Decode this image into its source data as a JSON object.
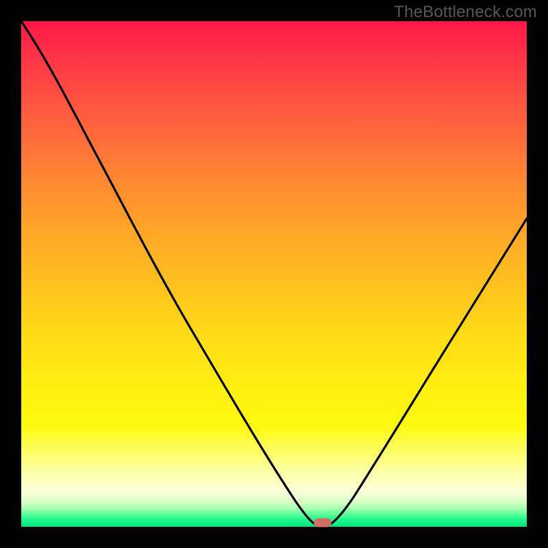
{
  "watermark": "TheBottleneck.com",
  "chart_data": {
    "type": "line",
    "title": "",
    "xlabel": "",
    "ylabel": "",
    "xlim": [
      0,
      100
    ],
    "ylim": [
      0,
      100
    ],
    "grid": false,
    "legend": false,
    "series": [
      {
        "name": "curve",
        "x": [
          0,
          5,
          10,
          15,
          20,
          25,
          30,
          35,
          40,
          45,
          50,
          54,
          56,
          58,
          59,
          60,
          61,
          62,
          64,
          68,
          72,
          76,
          80,
          84,
          88,
          92,
          96,
          100
        ],
        "values": [
          100,
          92,
          83,
          74,
          66,
          58,
          50,
          42,
          34,
          26,
          18,
          10,
          6,
          2,
          0,
          0,
          0,
          2,
          6,
          14,
          21,
          28,
          34,
          40,
          46,
          51,
          56,
          61
        ]
      }
    ],
    "marker": {
      "x": 59.5,
      "y": 0,
      "color": "#d36e64"
    },
    "background_gradient": {
      "type": "vertical",
      "stops": [
        {
          "pos": 0.0,
          "color": "#ff1749"
        },
        {
          "pos": 0.5,
          "color": "#ffc11f"
        },
        {
          "pos": 0.8,
          "color": "#fffa0f"
        },
        {
          "pos": 0.95,
          "color": "#d7ffc6"
        },
        {
          "pos": 1.0,
          "color": "#00e77e"
        }
      ]
    }
  }
}
